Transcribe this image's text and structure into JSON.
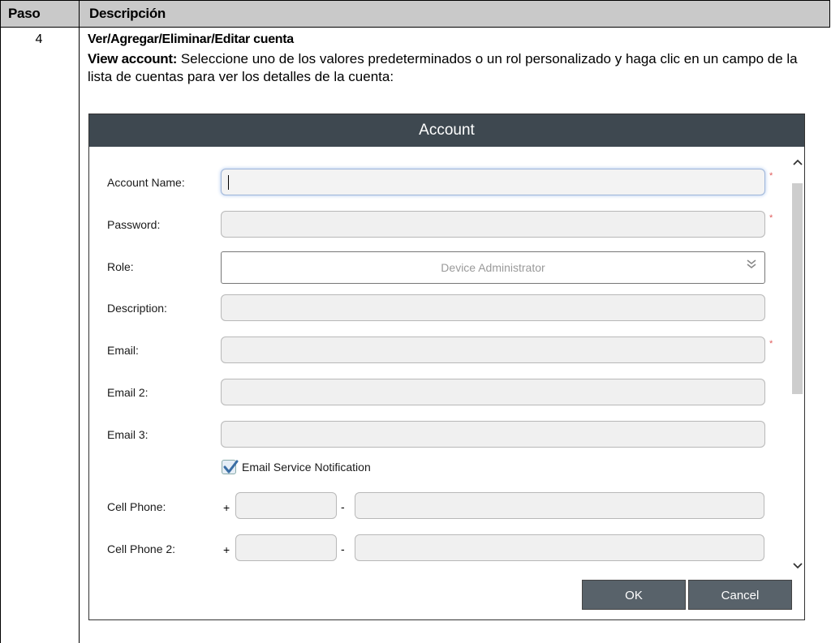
{
  "table": {
    "header_step": "Paso",
    "header_description": "Descripción",
    "step_number": "4",
    "step_title": "Ver/Agregar/Eliminar/Editar cuenta",
    "body_bold": "View account:",
    "body_text": " Seleccione uno de los valores predeterminados o un rol personalizado y haga clic en un campo de la lista de cuentas para ver los detalles de la cuenta:"
  },
  "dialog": {
    "title": "Account",
    "fields": {
      "account_name": "Account Name:",
      "password": "Password:",
      "role": "Role:",
      "description": "Description:",
      "email": "Email:",
      "email2": "Email 2:",
      "email3": "Email 3:",
      "cell_phone": "Cell Phone:",
      "cell_phone2": "Cell Phone 2:"
    },
    "values": {
      "account_name": "",
      "password": "",
      "description": "",
      "email": "",
      "email2": "",
      "email3": "",
      "cell_phone_country": "",
      "cell_phone_number": "",
      "cell_phone2_country": "",
      "cell_phone2_number": ""
    },
    "role_selected": "Device Administrator",
    "required_marker": "*",
    "checkbox_label": "Email Service Notification",
    "checkbox_checked": true,
    "plus_sign": "+",
    "dash_sign": "-",
    "ok_label": "OK",
    "cancel_label": "Cancel"
  },
  "icons": {
    "select_chevron": "double-chevron-down-icon",
    "scroll_up": "chevron-up-icon",
    "scroll_down": "chevron-down-icon",
    "checkmark": "checkmark-icon"
  },
  "colors": {
    "dialog_title_bg": "#3e4850",
    "button_bg": "#58626a",
    "header_bg": "#c9c9c9",
    "required": "#e05a5a"
  }
}
